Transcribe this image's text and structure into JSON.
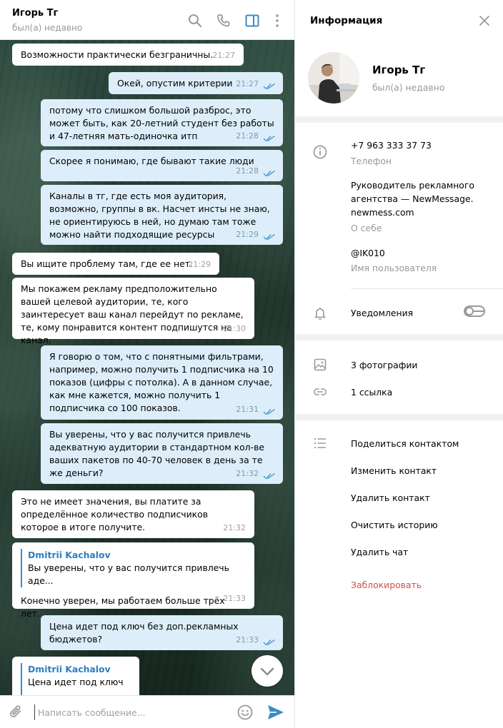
{
  "chat": {
    "header": {
      "name": "Игорь Тг",
      "status": "был(а) недавно"
    },
    "messages": [
      {
        "dir": "in",
        "text": "Возможности практически безграничны.",
        "time": "21:27"
      },
      {
        "dir": "out",
        "text": "Окей, опустим критерии",
        "time": "21:27"
      },
      {
        "dir": "out",
        "text": "потому что слишком большой разброс, это может быть, как 20-летний студент без работы и 47-летняя мать-одиночка итп",
        "time": "21:28"
      },
      {
        "dir": "out",
        "text": "Скорее я понимаю, где бывают такие люди",
        "time": "21:28"
      },
      {
        "dir": "out",
        "text": "Каналы в тг, где есть моя аудитория, возможно, группы в вк. Насчет инсты не знаю, не ориентируюсь в ней, но думаю там тоже можно найти подходящие ресурсы",
        "time": "21:29"
      },
      {
        "dir": "in",
        "text": "Вы ищите проблему там, где ее нет.",
        "time": "21:29"
      },
      {
        "dir": "in",
        "text": "Мы покажем рекламу предположительно вашей целевой аудитории, те, кого заинтересует ваш канал перейдут по рекламе, те, кому понравится контент подпишутся на канал.",
        "time": "21:30"
      },
      {
        "dir": "out",
        "text": "Я говорю о том, что с понятными фильтрами, например, можно получить 1 подписчика на 10 показов (цифры с потолка). А в данном случае, как мне кажется, можно получить 1 подписчика со 100 показов.",
        "time": "21:31"
      },
      {
        "dir": "out",
        "text": "Вы уверены, что у вас получится привлечь адекватную аудитории в стандартном кол-ве ваших пакетов по 40-70 человек в день за те же деньги?",
        "time": "21:32"
      },
      {
        "dir": "in",
        "text": "Это не имеет значения, вы платите за определённое количество подписчиков которое в итоге получите.",
        "time": "21:32"
      },
      {
        "dir": "in",
        "reply_author": "Dmitrii Kachalov",
        "reply_text": "Вы уверены, что у вас получится привлечь аде...",
        "text": "Конечно уверен, мы работаем больше трёх лет.",
        "time": "21:33"
      },
      {
        "dir": "out",
        "text": "Цена идет под ключ без доп.рекламных бюджетов?",
        "time": "21:33"
      },
      {
        "dir": "in",
        "reply_author": "Dmitrii Kachalov",
        "reply_text": "Цена идет под ключ ...",
        "text": "",
        "time": ""
      }
    ],
    "composer": {
      "placeholder": "Написать сообщение..."
    }
  },
  "info": {
    "title": "Информация",
    "profile": {
      "name": "Игорь Тг",
      "status": "был(а) недавно"
    },
    "phone": {
      "value": "+7 963 333 37 73",
      "label": "Телефон"
    },
    "bio": {
      "value": "Руководитель рекламного агентства — NewMessage. newmess.com",
      "label": "О себе"
    },
    "username": {
      "value": "@IK010",
      "label": "Имя пользователя"
    },
    "notifications": {
      "label": "Уведомления",
      "enabled": false
    },
    "media": {
      "photos": "3 фотографии",
      "links": "1 ссылка"
    },
    "actions": {
      "share": "Поделиться контактом",
      "edit": "Изменить контакт",
      "delete_contact": "Удалить контакт",
      "clear_history": "Очистить историю",
      "delete_chat": "Удалить чат",
      "block": "Заблокировать"
    }
  },
  "colors": {
    "accent": "#3a8bc8",
    "danger": "#d14e4e",
    "outgoing_bubble": "#ddeefa"
  }
}
